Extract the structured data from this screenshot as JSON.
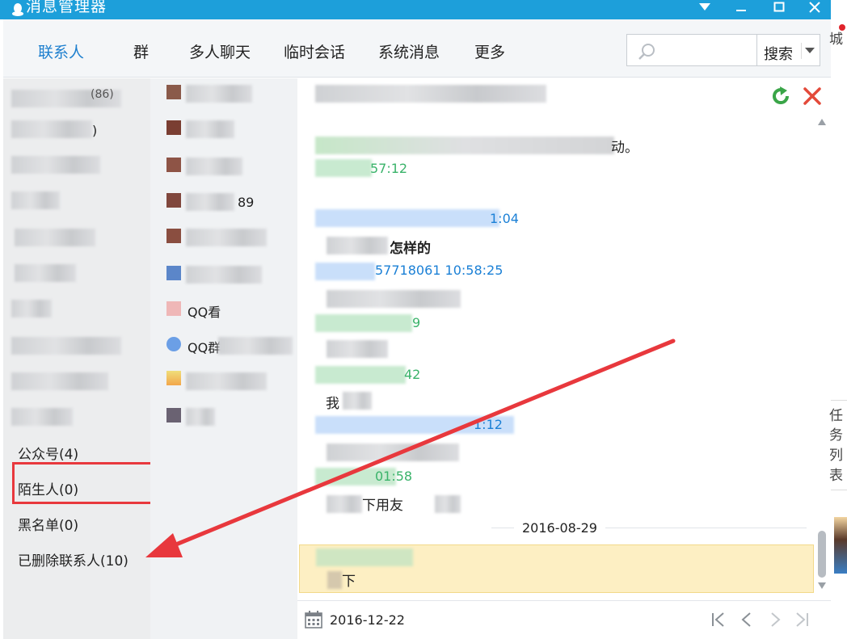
{
  "window": {
    "title": "消息管理器",
    "accent": "#1d9fda"
  },
  "toolbar": {
    "tabs": [
      "联系人",
      "群",
      "多人聊天",
      "临时会话",
      "系统消息",
      "更多"
    ],
    "active_tab": "联系人",
    "search_placeholder": "",
    "search_label": "搜索"
  },
  "groups": {
    "items": [
      "公众号(4)",
      "陌生人(0)",
      "黑名单(0)",
      "已删除联系人(10)"
    ],
    "partial_labels": [
      "(86)",
      ")"
    ]
  },
  "contacts": {
    "partial_labels": [
      "89",
      "QQ看",
      "QQ群"
    ]
  },
  "messages": {
    "partial_texts": [
      "动。",
      "怎样的",
      "我",
      "下用友",
      "下"
    ],
    "sender_fragments": [
      "57:12",
      "1:04",
      "57718061 10:58:25",
      "9",
      "42",
      "1:12",
      "01:58"
    ],
    "date_separator": "2016-08-29"
  },
  "footer": {
    "date": "2016-12-22"
  },
  "background_window": {
    "chars": [
      "城",
      "任",
      "务",
      "列",
      "表"
    ]
  },
  "annotation": {
    "arrow_color": "#e8383d"
  }
}
